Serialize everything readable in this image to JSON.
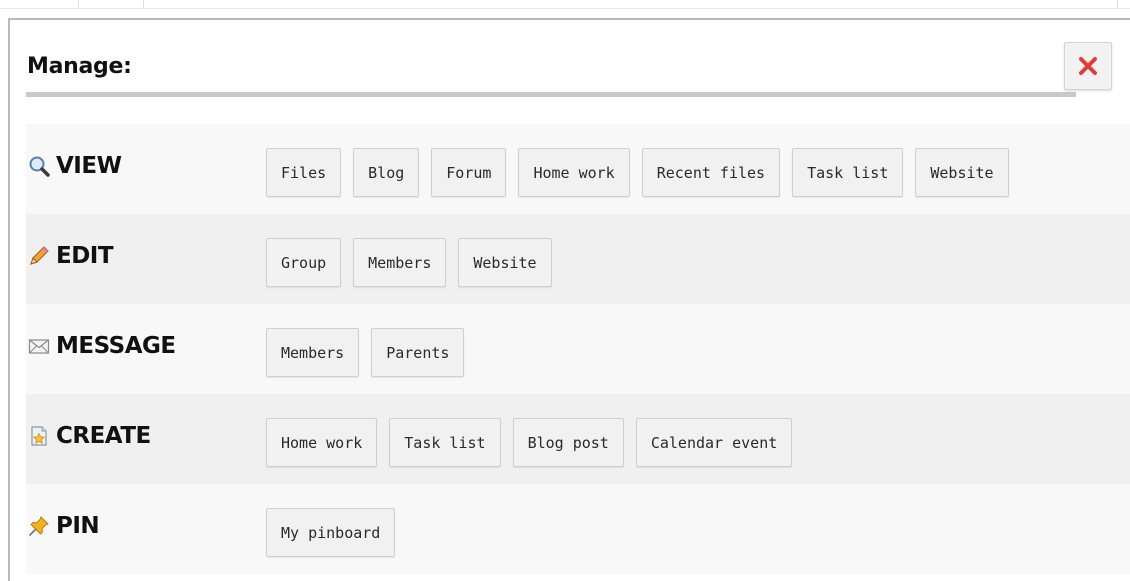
{
  "dialog": {
    "title": "Manage:",
    "close_icon": "close-x-icon",
    "close_color": "#e23b3b"
  },
  "rows": [
    {
      "label": "VIEW",
      "icon": "magnifier-icon",
      "buttons": [
        "Files",
        "Blog",
        "Forum",
        "Home work",
        "Recent files",
        "Task list",
        "Website"
      ]
    },
    {
      "label": "EDIT",
      "icon": "pencil-icon",
      "buttons": [
        "Group",
        "Members",
        "Website"
      ]
    },
    {
      "label": "MESSAGE",
      "icon": "envelope-icon",
      "buttons": [
        "Members",
        "Parents"
      ]
    },
    {
      "label": "CREATE",
      "icon": "star-document-icon",
      "buttons": [
        "Home work",
        "Task list",
        "Blog post",
        "Calendar event"
      ]
    },
    {
      "label": "PIN",
      "icon": "pushpin-icon",
      "buttons": [
        "My pinboard"
      ]
    }
  ]
}
